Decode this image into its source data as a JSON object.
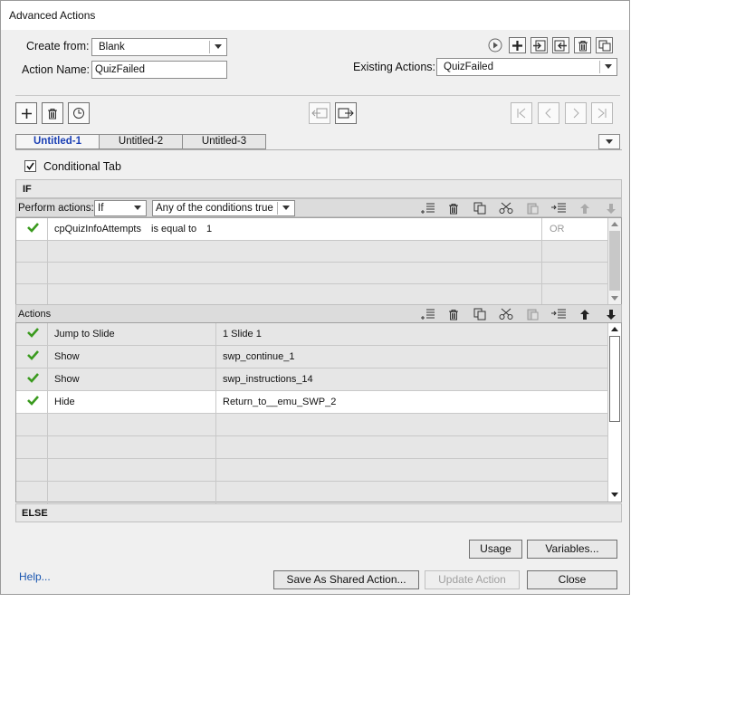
{
  "window": {
    "title": "Advanced Actions"
  },
  "form": {
    "create_from_label": "Create from:",
    "create_from_value": "Blank",
    "action_name_label": "Action Name:",
    "action_name_value": "QuizFailed",
    "existing_actions_label": "Existing Actions:",
    "existing_actions_value": "QuizFailed"
  },
  "header_icons": [
    "preview-icon",
    "add-icon",
    "import-icon",
    "export-icon",
    "delete-icon",
    "duplicate-icon"
  ],
  "decision_toolbar": {
    "left": [
      "add-decision-icon",
      "delete-decision-icon",
      "duplicate-decision-icon"
    ],
    "middle": [
      "move-left-icon",
      "move-right-icon"
    ],
    "right": [
      "first-icon",
      "previous-icon",
      "next-icon",
      "last-icon"
    ]
  },
  "tabs": [
    {
      "label": "Untitled-1",
      "active": true
    },
    {
      "label": "Untitled-2",
      "active": false
    },
    {
      "label": "Untitled-3",
      "active": false
    }
  ],
  "conditional": {
    "label": "Conditional Tab",
    "checked": true
  },
  "if_section": {
    "label": "IF"
  },
  "perform": {
    "label": "Perform actions:",
    "mode": "If",
    "condition": "Any of the conditions true"
  },
  "conditions": {
    "rows": [
      {
        "enabled": true,
        "variable": "cpQuizInfoAttempts",
        "operator": "is equal to",
        "value": "1",
        "logic": "OR"
      },
      {
        "enabled": false,
        "variable": "",
        "operator": "",
        "value": "",
        "logic": ""
      },
      {
        "enabled": false,
        "variable": "",
        "operator": "",
        "value": "",
        "logic": ""
      },
      {
        "enabled": false,
        "variable": "",
        "operator": "",
        "value": "",
        "logic": ""
      }
    ]
  },
  "actions_section": {
    "label": "Actions"
  },
  "actions": {
    "rows": [
      {
        "enabled": true,
        "action": "Jump to Slide",
        "target": "1 Slide 1"
      },
      {
        "enabled": true,
        "action": "Show",
        "target": "swp_continue_1"
      },
      {
        "enabled": true,
        "action": "Show",
        "target": "swp_instructions_14"
      },
      {
        "enabled": true,
        "action": "Hide",
        "target": "Return_to__emu_SWP_2"
      },
      {
        "enabled": false,
        "action": "",
        "target": ""
      },
      {
        "enabled": false,
        "action": "",
        "target": ""
      },
      {
        "enabled": false,
        "action": "",
        "target": ""
      },
      {
        "enabled": false,
        "action": "",
        "target": ""
      }
    ]
  },
  "else_section": {
    "label": "ELSE"
  },
  "buttons": {
    "usage": "Usage",
    "variables": "Variables...",
    "help": "Help...",
    "save_shared": "Save As Shared Action...",
    "update": "Update Action",
    "close": "Close"
  },
  "colors": {
    "check": "#3a9a1e",
    "link": "#1a56b0",
    "active_tab": "#1a3fb4"
  }
}
